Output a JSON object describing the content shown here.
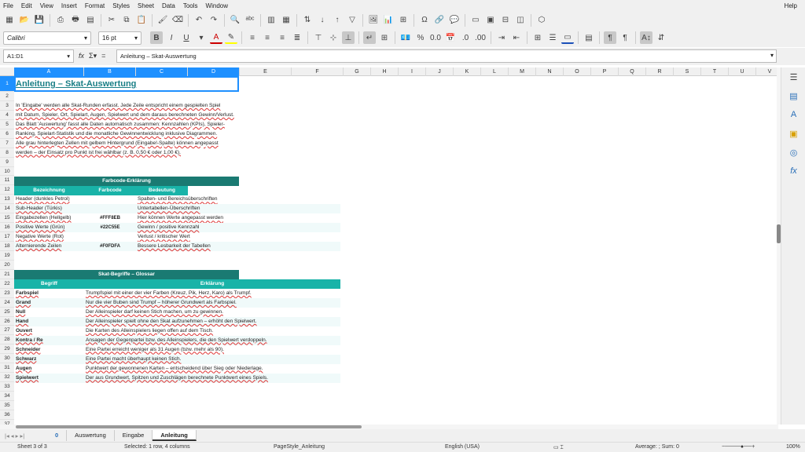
{
  "menu": [
    "File",
    "Edit",
    "View",
    "Insert",
    "Format",
    "Styles",
    "Sheet",
    "Data",
    "Tools",
    "Window",
    "Help"
  ],
  "font": {
    "name": "Calibri",
    "size": "16 pt"
  },
  "namebox": "A1:D1",
  "formula": "Anleitung – Skat-Auswertung",
  "columns": [
    "A",
    "B",
    "C",
    "D",
    "E",
    "F",
    "G",
    "H",
    "I",
    "J",
    "K",
    "L",
    "M",
    "N",
    "O",
    "P",
    "Q",
    "R",
    "S",
    "T",
    "U",
    "V"
  ],
  "rows": [
    "1",
    "2",
    "3",
    "4",
    "5",
    "6",
    "7",
    "8",
    "9",
    "10",
    "11",
    "12",
    "13",
    "14",
    "15",
    "16",
    "17",
    "18",
    "19",
    "20",
    "21",
    "22",
    "23",
    "24",
    "25",
    "26",
    "27",
    "28",
    "29",
    "30",
    "31",
    "32",
    "33",
    "34",
    "35",
    "36",
    "37"
  ],
  "title": "Anleitung – Skat-Auswertung",
  "intro": [
    "In 'Eingabe' werden alle Skat-Runden erfasst. Jede Zeile entspricht einem gespielten Spiel",
    "mit Datum, Spieler, Ort, Spielart, Augen, Spielwert und dem daraus berechneten Gewinn/Verlust.",
    "Das Blatt 'Auswertung' fasst alle Daten automatisch zusammen: Kennzahlen (KPIs), Spieler-",
    "Ranking, Spielart-Statistik und die monatliche Gewinnentwicklung inklusive Diagrammen.",
    "Alle grau hinterlegten Zellen mit gelbem Hintergrund (Eingabe!-Spalte) können angepasst",
    "werden – der Einsatz pro Punkt ist frei wählbar (z. B. 0,50 € oder 1,00 €)."
  ],
  "colorcode": {
    "heading": "Farbcode-Erklärung",
    "headers": [
      "Bezeichnung",
      "Farbcode",
      "Bedeutung"
    ],
    "rows": [
      [
        "Header (dunkles Petrol)",
        "",
        "Spalten- und Bereichsüberschriften"
      ],
      [
        "Sub-Header (Türkis)",
        "",
        "Untertabellen-Überschriften"
      ],
      [
        "Eingabezellen (Hellgelb)",
        "#FFF8EB",
        "Hier können Werte angepasst werden"
      ],
      [
        "Positive Werte (Grün)",
        "#22C55E",
        "Gewinn / positive Kennzahl"
      ],
      [
        "Negative Werte (Rot)",
        "",
        "Verlust / kritischer Wert"
      ],
      [
        "Alternierende Zeilen",
        "#F0FDFA",
        "Bessere Lesbarkeit der Tabellen"
      ]
    ]
  },
  "glossary": {
    "heading": "Skat-Begriffe – Glossar",
    "headers": [
      "Begriff",
      "Erklärung"
    ],
    "rows": [
      [
        "Farbspiel",
        "Trumpfspiel mit einer der vier Farben (Kreuz, Pik, Herz, Karo) als Trumpf."
      ],
      [
        "Grand",
        "Nur die vier Buben sind Trumpf – höherer Grundwert als Farbspiel."
      ],
      [
        "Null",
        "Der Alleinspieler darf keinen Stich machen, um zu gewinnen."
      ],
      [
        "Hand",
        "Der Alleinspieler spielt ohne den Skat aufzunehmen – erhöht den Spielwert."
      ],
      [
        "Ouvert",
        "Die Karten des Alleinspielers liegen offen auf dem Tisch."
      ],
      [
        "Kontra / Re",
        "Ansagen der Gegenpartei bzw. des Alleinspielers, die den Spielwert verdoppeln."
      ],
      [
        "Schneider",
        "Eine Partei erreicht weniger als 31 Augen (bzw. mehr als 90)."
      ],
      [
        "Schwarz",
        "Eine Partei macht überhaupt keinen Stich."
      ],
      [
        "Augen",
        "Punktwert der gewonnenen Karten – entscheidend über Sieg oder Niederlage."
      ],
      [
        "Spielwert",
        "Der aus Grundwert, Spitzen und Zuschlägen berechnete Punktwert eines Spiels."
      ]
    ]
  },
  "tabs": [
    "0",
    "Auswertung",
    "Eingabe",
    "Anleitung"
  ],
  "status": {
    "sheet": "Sheet 3 of 3",
    "selected": "Selected: 1 row, 4 columns",
    "pagestyle": "PageStyle_Anleitung",
    "language": "English (USA)",
    "sum": "Average: ; Sum: 0",
    "zoom": "100%"
  }
}
